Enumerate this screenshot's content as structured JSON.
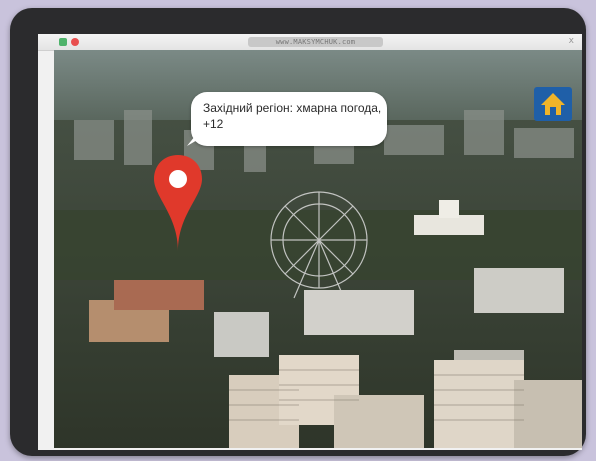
{
  "browser": {
    "url": "www.MAKSYMCHUK.com",
    "close_glyph": "x"
  },
  "map": {
    "tooltip_text": "Західний регіон: хмарна погода, +12",
    "pin_color": "#e0392b",
    "home_button_color": "#1f5fa8",
    "home_icon_color": "#f0b429"
  },
  "icons": [
    "home-icon",
    "location-pin-icon"
  ]
}
